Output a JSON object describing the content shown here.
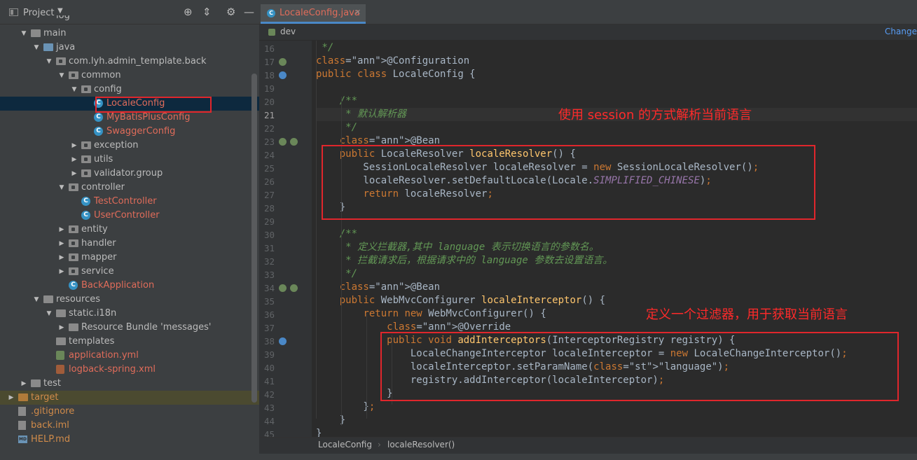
{
  "project_panel": {
    "title": "Project",
    "tree": [
      {
        "label": "main",
        "type": "folder",
        "expanded": true
      },
      {
        "label": "java",
        "type": "folder-blue",
        "expanded": true
      },
      {
        "label": "com.lyh.admin_template.back",
        "type": "package",
        "expanded": true
      },
      {
        "label": "common",
        "type": "package",
        "expanded": true
      },
      {
        "label": "config",
        "type": "package",
        "expanded": true
      },
      {
        "label": "LocaleConfig",
        "type": "class",
        "selected": true
      },
      {
        "label": "MyBatisPlusConfig",
        "type": "class"
      },
      {
        "label": "SwaggerConfig",
        "type": "class"
      },
      {
        "label": "exception",
        "type": "package",
        "expanded": false
      },
      {
        "label": "utils",
        "type": "package",
        "expanded": false
      },
      {
        "label": "validator.group",
        "type": "package",
        "expanded": false
      },
      {
        "label": "controller",
        "type": "package",
        "expanded": true
      },
      {
        "label": "TestController",
        "type": "class"
      },
      {
        "label": "UserController",
        "type": "class"
      },
      {
        "label": "entity",
        "type": "package",
        "expanded": false
      },
      {
        "label": "handler",
        "type": "package",
        "expanded": false
      },
      {
        "label": "mapper",
        "type": "package",
        "expanded": false
      },
      {
        "label": "service",
        "type": "package",
        "expanded": false
      },
      {
        "label": "BackApplication",
        "type": "spring-class"
      },
      {
        "label": "resources",
        "type": "folder",
        "expanded": true
      },
      {
        "label": "static.i18n",
        "type": "folder",
        "expanded": true
      },
      {
        "label": "Resource Bundle 'messages'",
        "type": "bundle",
        "expanded": false
      },
      {
        "label": "templates",
        "type": "folder"
      },
      {
        "label": "application.yml",
        "type": "yml"
      },
      {
        "label": "logback-spring.xml",
        "type": "xml"
      },
      {
        "label": "test",
        "type": "folder",
        "expanded": false
      },
      {
        "label": "target",
        "type": "folder-orange",
        "expanded": false
      },
      {
        "label": ".gitignore",
        "type": "file"
      },
      {
        "label": "back.iml",
        "type": "file"
      },
      {
        "label": "HELP.md",
        "type": "md"
      }
    ]
  },
  "editor": {
    "tab_label": "LocaleConfig.java",
    "branch": "dev",
    "change_link": "Change",
    "lines": [
      {
        "n": "16",
        "text": " */"
      },
      {
        "n": "17",
        "text": "@Configuration"
      },
      {
        "n": "18",
        "text": "public class LocaleConfig {"
      },
      {
        "n": "19",
        "text": ""
      },
      {
        "n": "20",
        "text": "    /**"
      },
      {
        "n": "21",
        "text": "     * 默认解析器"
      },
      {
        "n": "22",
        "text": "     */"
      },
      {
        "n": "23",
        "text": "    @Bean"
      },
      {
        "n": "24",
        "text": "    public LocaleResolver localeResolver() {"
      },
      {
        "n": "25",
        "text": "        SessionLocaleResolver localeResolver = new SessionLocaleResolver();"
      },
      {
        "n": "26",
        "text": "        localeResolver.setDefaultLocale(Locale.SIMPLIFIED_CHINESE);"
      },
      {
        "n": "27",
        "text": "        return localeResolver;"
      },
      {
        "n": "28",
        "text": "    }"
      },
      {
        "n": "29",
        "text": ""
      },
      {
        "n": "30",
        "text": "    /**"
      },
      {
        "n": "31",
        "text": "     * 定义拦截器,其中 language 表示切换语言的参数名。"
      },
      {
        "n": "32",
        "text": "     * 拦截请求后，根据请求中的 language 参数去设置语言。"
      },
      {
        "n": "33",
        "text": "     */"
      },
      {
        "n": "34",
        "text": "    @Bean"
      },
      {
        "n": "35",
        "text": "    public WebMvcConfigurer localeInterceptor() {"
      },
      {
        "n": "36",
        "text": "        return new WebMvcConfigurer() {"
      },
      {
        "n": "37",
        "text": "            @Override"
      },
      {
        "n": "38",
        "text": "            public void addInterceptors(InterceptorRegistry registry) {"
      },
      {
        "n": "39",
        "text": "                LocaleChangeInterceptor localeInterceptor = new LocaleChangeInterceptor();"
      },
      {
        "n": "40",
        "text": "                localeInterceptor.setParamName(\"language\");"
      },
      {
        "n": "41",
        "text": "                registry.addInterceptor(localeInterceptor);"
      },
      {
        "n": "42",
        "text": "            }"
      },
      {
        "n": "43",
        "text": "        };"
      },
      {
        "n": "44",
        "text": "    }"
      },
      {
        "n": "45",
        "text": "}"
      }
    ],
    "breadcrumbs": [
      "LocaleConfig",
      "localeResolver()"
    ]
  },
  "annotations": {
    "session_note": "使用 session 的方式解析当前语言",
    "filter_note": "定义一个过滤器，用于获取当前语言"
  },
  "colors": {
    "annotation_red": "#ff2a2a",
    "keyword": "#cc7832",
    "annotation": "#bbb529",
    "function": "#ffc66d",
    "comment": "#629755",
    "string": "#6a8759",
    "constant": "#9876aa"
  }
}
